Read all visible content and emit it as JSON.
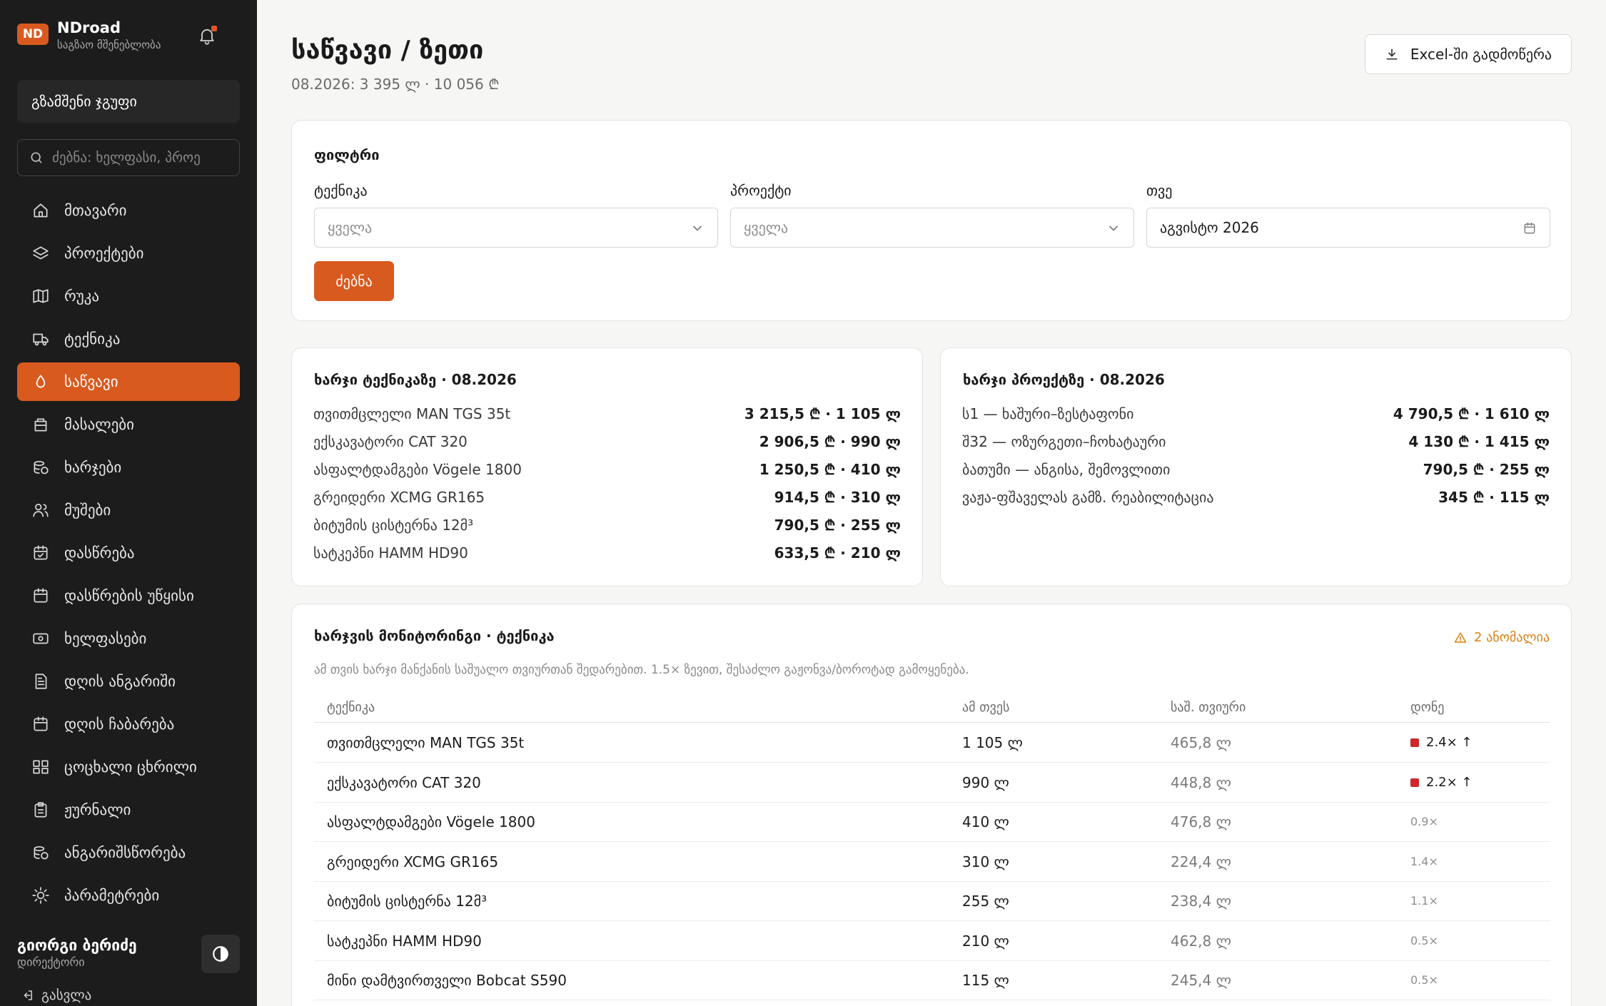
{
  "brand": {
    "logo": "ND",
    "name": "NDroad",
    "subtitle": "საგზაო მშენებლობა"
  },
  "group": "გზამშენი ჯგუფი",
  "sidebar_search": {
    "placeholder": "ძებნა: ხელფასი, პროე"
  },
  "nav": [
    {
      "label": "მთავარი",
      "icon": "home-icon",
      "active": false
    },
    {
      "label": "პროექტები",
      "icon": "layers-icon",
      "active": false
    },
    {
      "label": "რუკა",
      "icon": "map-icon",
      "active": false
    },
    {
      "label": "ტექნიკა",
      "icon": "truck-icon",
      "active": false
    },
    {
      "label": "საწვავი",
      "icon": "fuel-drop-icon",
      "active": true
    },
    {
      "label": "მასალები",
      "icon": "materials-icon",
      "active": false
    },
    {
      "label": "ხარჯები",
      "icon": "coins-icon",
      "active": false
    },
    {
      "label": "მუშები",
      "icon": "users-icon",
      "active": false
    },
    {
      "label": "დასწრება",
      "icon": "calendar-check-icon",
      "active": false
    },
    {
      "label": "დასწრების უწყისი",
      "icon": "calendar-icon",
      "active": false
    },
    {
      "label": "ხელფასები",
      "icon": "banknote-icon",
      "active": false
    },
    {
      "label": "დღის ანგარიში",
      "icon": "file-text-icon",
      "active": false
    },
    {
      "label": "დღის ჩაბარება",
      "icon": "calendar-icon",
      "active": false
    },
    {
      "label": "ცოცხალი ცხრილი",
      "icon": "grid-icon",
      "active": false
    },
    {
      "label": "ჟურნალი",
      "icon": "clipboard-icon",
      "active": false
    },
    {
      "label": "ანგარიშსწორება",
      "icon": "coins-icon",
      "active": false
    },
    {
      "label": "პარამეტრები",
      "icon": "sun-icon",
      "active": false
    }
  ],
  "user": {
    "name": "გიორგი ბერიძე",
    "role": "დირექტორი"
  },
  "logout_label": "გასვლა",
  "page": {
    "title": "საწვავი / ზეთი",
    "subtitle": "08.2026: 3 395 ლ · 10 056 ₾"
  },
  "export_label": "Excel-ში გადმოწერა",
  "filter": {
    "title": "ფილტრი",
    "fields": [
      {
        "label": "ტექნიკა",
        "value": "ყველა"
      },
      {
        "label": "პროექტი",
        "value": "ყველა"
      },
      {
        "label": "თვე",
        "value": "აგვისტო 2026"
      }
    ],
    "search_label": "ძებნა"
  },
  "cost_by_equipment": {
    "title": "ხარჯი ტექნიკაზე · 08.2026",
    "rows": [
      {
        "name": "თვითმცლელი MAN TGS 35t",
        "value": "3 215,5 ₾ · 1 105 ლ"
      },
      {
        "name": "ექსკავატორი CAT 320",
        "value": "2 906,5 ₾ · 990 ლ"
      },
      {
        "name": "ასფალტდამგები Vögele 1800",
        "value": "1 250,5 ₾ · 410 ლ"
      },
      {
        "name": "გრეიდერი XCMG GR165",
        "value": "914,5 ₾ · 310 ლ"
      },
      {
        "name": "ბიტუმის ცისტერნა 12მ³",
        "value": "790,5 ₾ · 255 ლ"
      },
      {
        "name": "სატკეპნი HAMM HD90",
        "value": "633,5 ₾ · 210 ლ"
      }
    ]
  },
  "cost_by_project": {
    "title": "ხარჯი პროექტზე · 08.2026",
    "rows": [
      {
        "name": "ს1 — ხაშური–ზესტაფონი",
        "value": "4 790,5 ₾ · 1 610 ლ"
      },
      {
        "name": "შ32 — ოზურგეთი–ჩოხატაური",
        "value": "4 130 ₾ · 1 415 ლ"
      },
      {
        "name": "ბათუმი — ანგისა, შემოვლითი",
        "value": "790,5 ₾ · 255 ლ"
      },
      {
        "name": "ვაჟა-ფშაველას გამზ. რეაბილიტაცია",
        "value": "345 ₾ · 115 ლ"
      }
    ]
  },
  "monitoring": {
    "title": "ხარჯვის მონიტორინგი · ტექნიკა",
    "anomaly_label": "2 ანომალია",
    "description": "ამ თვის ხარჯი მანქანის საშუალო თვიურთან შედარებით. 1.5× ზევით, შესაძლო გაჟონვა/ბოროტად გამოყენება.",
    "columns": [
      "ტექნიკა",
      "ამ თვეს",
      "საშ. თვიური",
      "დონე"
    ],
    "rows": [
      {
        "name": "თვითმცლელი MAN TGS 35t",
        "this_month": "1 105 ლ",
        "avg": "465,8 ლ",
        "level": "2.4× ↑",
        "high": true
      },
      {
        "name": "ექსკავატორი CAT 320",
        "this_month": "990 ლ",
        "avg": "448,8 ლ",
        "level": "2.2× ↑",
        "high": true
      },
      {
        "name": "ასფალტდამგები Vögele 1800",
        "this_month": "410 ლ",
        "avg": "476,8 ლ",
        "level": "0.9×",
        "high": false
      },
      {
        "name": "გრეიდერი XCMG GR165",
        "this_month": "310 ლ",
        "avg": "224,4 ლ",
        "level": "1.4×",
        "high": false
      },
      {
        "name": "ბიტუმის ცისტერნა 12მ³",
        "this_month": "255 ლ",
        "avg": "238,4 ლ",
        "level": "1.1×",
        "high": false
      },
      {
        "name": "სატკეპნი HAMM HD90",
        "this_month": "210 ლ",
        "avg": "462,8 ლ",
        "level": "0.5×",
        "high": false
      },
      {
        "name": "მინი დამტვირთველი Bobcat S590",
        "this_month": "115 ლ",
        "avg": "245,4 ლ",
        "level": "0.5×",
        "high": false
      }
    ]
  },
  "colors": {
    "accent": "#d95a1e",
    "sidebar_bg": "#1c1c1c",
    "anomaly": "#d97f14",
    "danger": "#d0262e"
  }
}
